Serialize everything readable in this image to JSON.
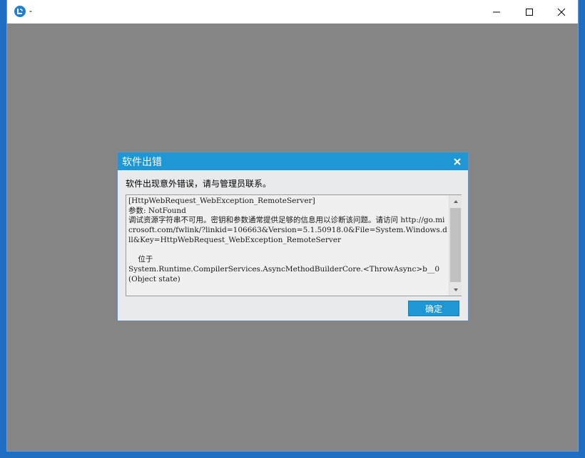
{
  "window": {
    "title": "-",
    "icon": "app-logo-icon",
    "controls": [
      "minimize-icon",
      "maximize-icon",
      "close-icon"
    ]
  },
  "dialog": {
    "title": "软件出错",
    "message": "软件出现意外错误，请与管理员联系。",
    "details": "[HttpWebRequest_WebException_RemoteServer]\n参数: NotFound\n调试资源字符串不可用。密钥和参数通常提供足够的信息用以诊断该问题。请访问 http://go.microsoft.com/fwlink/?linkid=106663&Version=5.1.50918.0&File=System.Windows.dll&Key=HttpWebRequest_WebException_RemoteServer\n\n    位于\nSystem.Runtime.CompilerServices.AsyncMethodBuilderCore.<ThrowAsync>b__0(Object state)",
    "ok_label": "确定"
  },
  "colors": {
    "accent": "#1e97d4",
    "client_background": "#858585",
    "desktop": "#1e6fc4"
  }
}
